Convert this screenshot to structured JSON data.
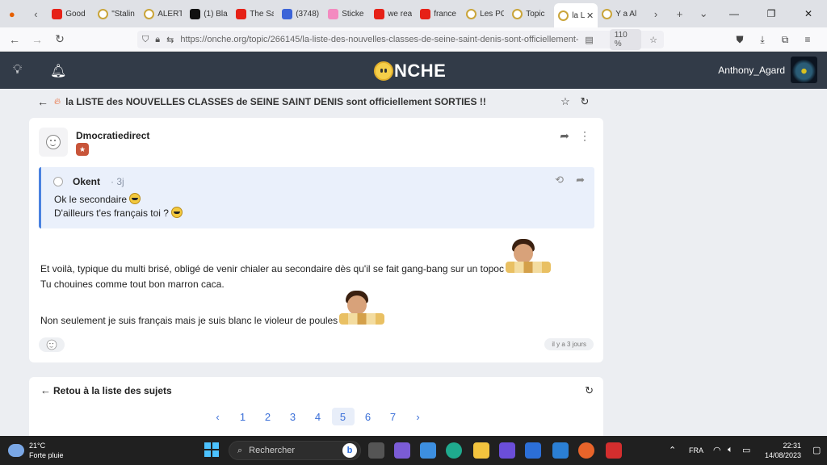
{
  "browser": {
    "tabs": [
      {
        "label": "Good",
        "icon": "youtube-icon",
        "color": "#e62117"
      },
      {
        "label": "\"Stalin",
        "icon": "onche-icon",
        "color": "#caa53a"
      },
      {
        "label": "ALERT",
        "icon": "onche-icon",
        "color": "#caa53a"
      },
      {
        "label": "(1) Bla",
        "icon": "x-icon",
        "color": "#111111"
      },
      {
        "label": "The Sa",
        "icon": "youtube-icon",
        "color": "#e62117"
      },
      {
        "label": "(3748)",
        "icon": "site-icon",
        "color": "#3c64d8"
      },
      {
        "label": "Sticke",
        "icon": "sticker-icon",
        "color": "#f38ac0"
      },
      {
        "label": "we rea",
        "icon": "youtube-icon",
        "color": "#e62117"
      },
      {
        "label": "france",
        "icon": "youtube-icon",
        "color": "#e62117"
      },
      {
        "label": "Les PC",
        "icon": "onche-icon",
        "color": "#caa53a"
      },
      {
        "label": "Topic",
        "icon": "onche-icon",
        "color": "#caa53a"
      },
      {
        "label": "la L",
        "icon": "onche-icon",
        "color": "#caa53a",
        "active": true
      },
      {
        "label": "Y a Al",
        "icon": "onche-icon",
        "color": "#caa53a"
      }
    ],
    "url": "https://onche.org/topic/266145/la-liste-des-nouvelles-classes-de-seine-saint-denis-sont-officiellement-sorties",
    "zoom": "110 %"
  },
  "site": {
    "logo_text": "NCHE",
    "username": "Anthony_Agard"
  },
  "topic": {
    "title": "la LISTE des NOUVELLES CLASSES de SEINE SAINT DENIS sont officiellement SORTIES !!"
  },
  "post": {
    "author": "Dmocratiedirect",
    "quote": {
      "author": "Okent",
      "time": "· 3j",
      "line1": "Ok le secondaire",
      "line2": "D'ailleurs t'es français toi ?"
    },
    "body_line1": "Et voilà, typique du multi brisé, obligé de venir chialer au secondaire dès qu'il se fait gang-bang sur un topoc",
    "body_line2": "Tu chouines comme tout bon marron caca.",
    "body_line3": "Non seulement je suis français mais je suis blanc le violeur de poules",
    "time_ago": "il y a 3 jours"
  },
  "footer_card": {
    "back_label": "Retou à la liste des sujets",
    "pages": [
      "‹",
      "1",
      "2",
      "3",
      "4",
      "5",
      "6",
      "7",
      "›"
    ],
    "current_page": "5"
  },
  "taskbar": {
    "temp": "21°C",
    "weather": "Forte pluie",
    "search_placeholder": "Rechercher",
    "lang": "FRA",
    "time": "22:31",
    "date": "14/08/2023"
  }
}
